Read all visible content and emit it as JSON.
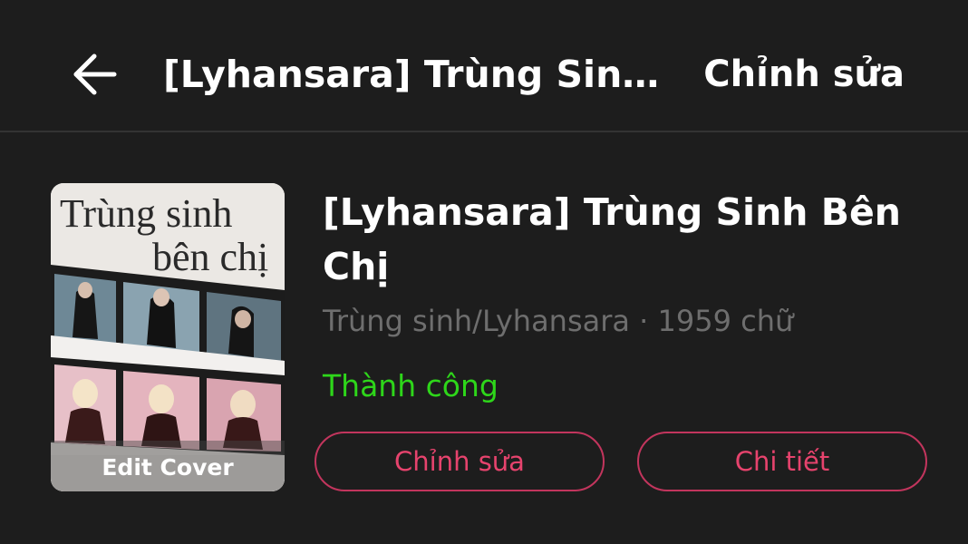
{
  "header": {
    "title": "[Lyhansara] Trùng Sinh...",
    "edit_label": "Chỉnh sửa"
  },
  "cover": {
    "title_line1": "Trùng sinh",
    "title_line2": "bên chị",
    "edit_label": "Edit Cover"
  },
  "story": {
    "title": "[Lyhansara] Trùng Sinh Bên Chị",
    "meta": "Trùng sinh/Lyhansara · 1959 chữ",
    "status": "Thành công"
  },
  "actions": {
    "edit_label": "Chỉnh sửa",
    "detail_label": "Chi tiết"
  },
  "colors": {
    "background": "#1d1d1d",
    "status_green": "#2ed61a",
    "accent_pink": "#e6436d"
  },
  "icons": {
    "back": "arrow-left-icon"
  }
}
